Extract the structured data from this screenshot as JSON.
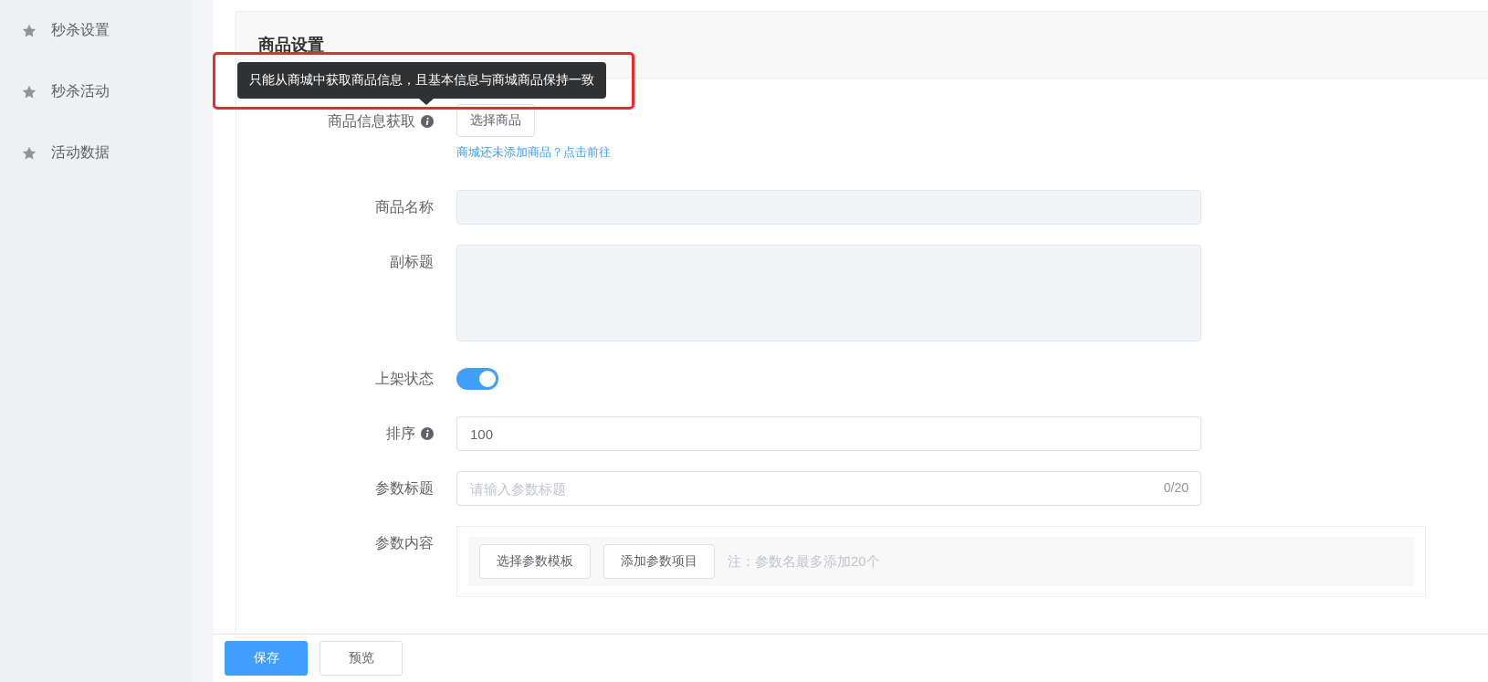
{
  "sidebar": {
    "items": [
      {
        "label": "秒杀设置"
      },
      {
        "label": "秒杀活动"
      },
      {
        "label": "活动数据"
      }
    ]
  },
  "section": {
    "title": "商品设置"
  },
  "tooltip": {
    "text": "只能从商城中获取商品信息，且基本信息与商城商品保持一致"
  },
  "form": {
    "rows": [
      {
        "kind": "picker",
        "label": "商品信息获取",
        "info": true,
        "button": "选择商品",
        "link": "商城还未添加商品？点击前往"
      },
      {
        "kind": "input",
        "label": "商品名称",
        "info": false,
        "disabled": true
      },
      {
        "kind": "textarea",
        "label": "副标题",
        "info": false,
        "disabled": true
      },
      {
        "kind": "switch",
        "label": "上架状态",
        "info": false,
        "on": true
      },
      {
        "kind": "input",
        "label": "排序",
        "info": true,
        "disabled": false,
        "value": "100"
      },
      {
        "kind": "input",
        "label": "参数标题",
        "info": false,
        "disabled": false,
        "placeholder": "请输入参数标题",
        "counter": "0/20"
      },
      {
        "kind": "params",
        "label": "参数内容",
        "info": false,
        "buttons": [
          "选择参数模板",
          "添加参数项目"
        ],
        "note": "注：参数名最多添加20个"
      }
    ]
  },
  "footer": {
    "buttons": [
      {
        "label": "保存",
        "kind": "primary"
      },
      {
        "label": "预览",
        "kind": "default"
      }
    ]
  }
}
